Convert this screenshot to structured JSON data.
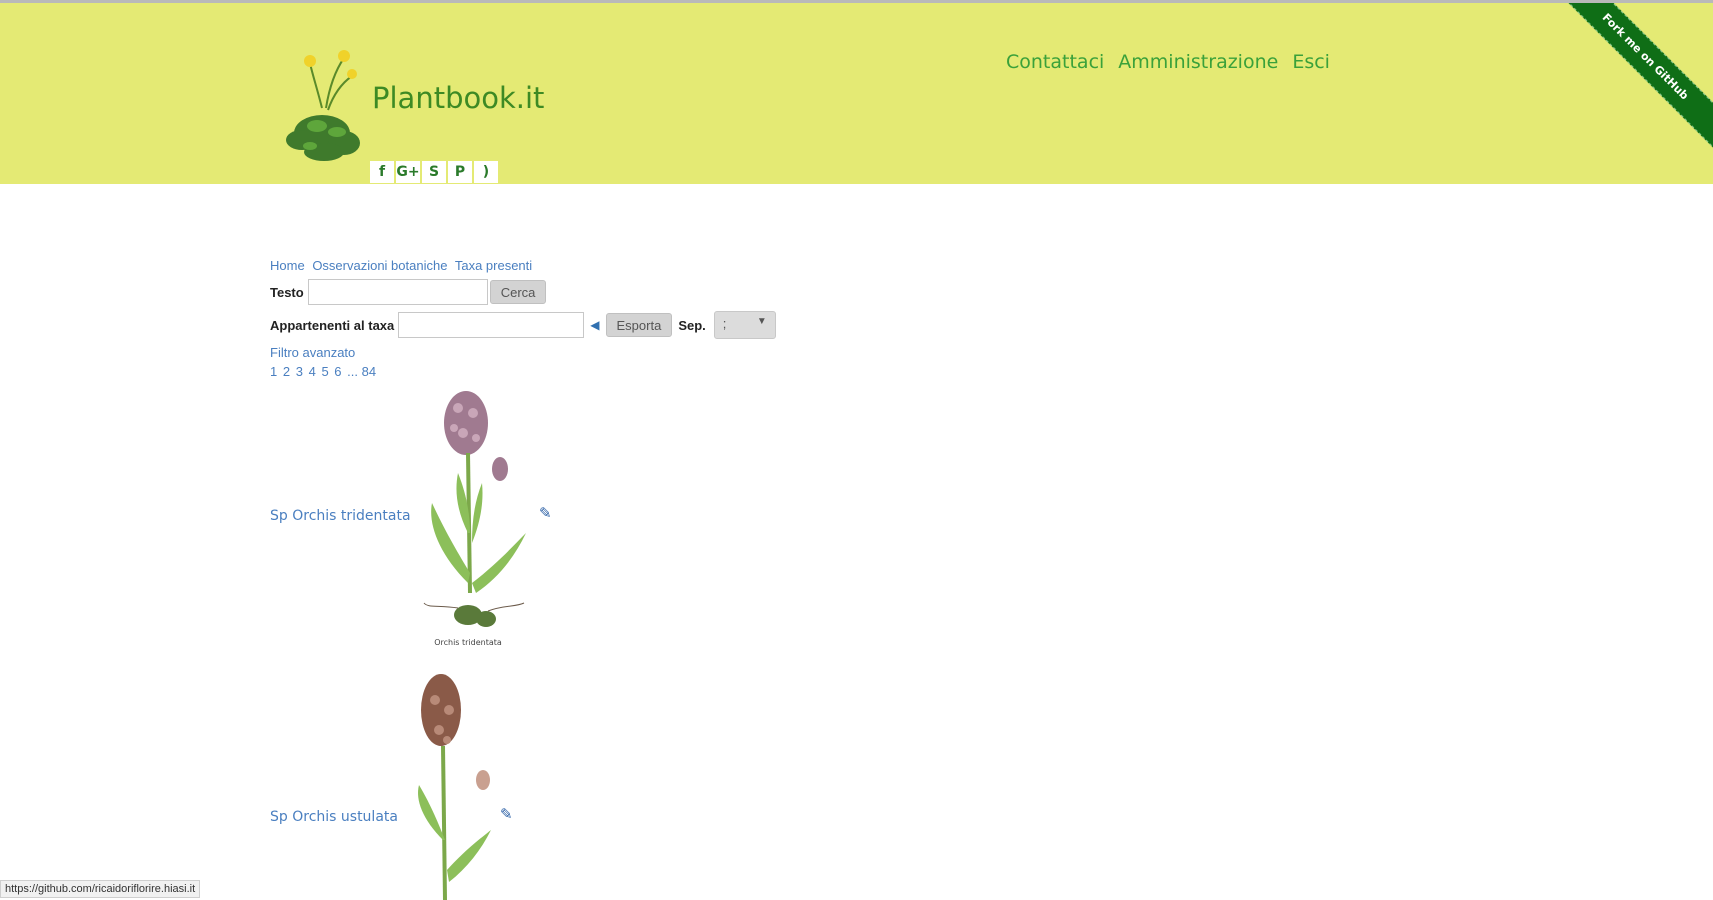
{
  "header": {
    "site_title": "Plantbook.it",
    "nav": [
      "Contattaci",
      "Amministrazione",
      "Esci"
    ],
    "social_icons": [
      "facebook-icon",
      "google-plus-icon",
      "skype-icon",
      "pinterest-icon",
      "rss-icon"
    ],
    "ribbon_text": "Fork me on GitHub",
    "bg_color": "#e4ea74",
    "accent_color": "#3aa13a"
  },
  "breadcrumb": [
    "Home",
    "Osservazioni botaniche",
    "Taxa presenti"
  ],
  "search": {
    "text_label": "Testo",
    "text_value": "",
    "search_button": "Cerca",
    "taxa_label": "Appartenenti al taxa",
    "taxa_value": "",
    "export_button": "Esporta",
    "sep_label": "Sep.",
    "sep_value": ";"
  },
  "advanced_filter": "Filtro avanzato",
  "pager": [
    "1",
    "2",
    "3",
    "4",
    "5",
    "6",
    "...",
    "84"
  ],
  "items": [
    {
      "name": "Sp Orchis tridentata",
      "caption": "Orchis tridentata"
    },
    {
      "name": "Sp Orchis ustulata",
      "caption": ""
    }
  ],
  "status_url": "https://github.com/ricaidoriflorire.hiasi.it"
}
